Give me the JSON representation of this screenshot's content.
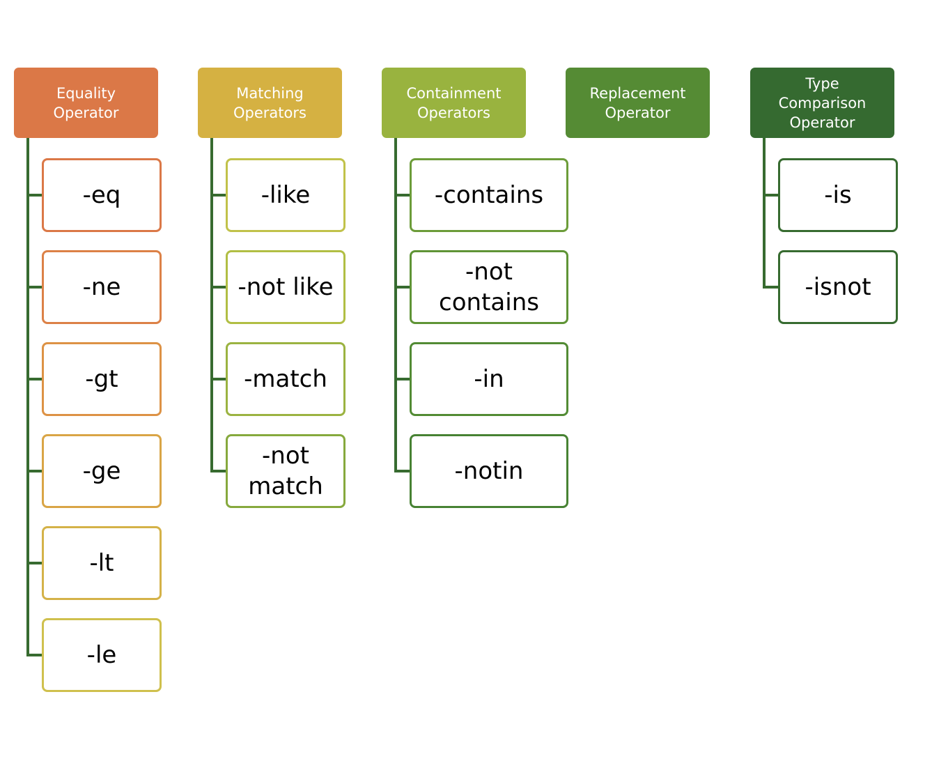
{
  "diagram": {
    "connector_color": "#376b30",
    "groups": [
      {
        "title": "Equality\nOperator",
        "color": "#db7847",
        "children": [
          {
            "label": "-eq",
            "border": "#db7847"
          },
          {
            "label": "-ne",
            "border": "#dc8147"
          },
          {
            "label": "-gt",
            "border": "#dd9245"
          },
          {
            "label": "-ge",
            "border": "#d9a546"
          },
          {
            "label": "-lt",
            "border": "#d4b248"
          },
          {
            "label": "-le",
            "border": "#cfc04d"
          }
        ]
      },
      {
        "title": "Matching\nOperators",
        "color": "#d5b142",
        "children": [
          {
            "label": "-like",
            "border": "#c1c24a"
          },
          {
            "label": "-not like",
            "border": "#b1be44"
          },
          {
            "label": "-match",
            "border": "#9bb341"
          },
          {
            "label": "-not\nmatch",
            "border": "#86a93d"
          }
        ]
      },
      {
        "title": "Containment\nOperators",
        "color": "#99b33f",
        "children": [
          {
            "label": "-contains",
            "border": "#6c9c39"
          },
          {
            "label": "-not\ncontains",
            "border": "#5f9436"
          },
          {
            "label": "-in",
            "border": "#528b34"
          },
          {
            "label": "-notin",
            "border": "#478233"
          }
        ]
      },
      {
        "title": "Replacement\nOperator",
        "color": "#558b34",
        "children": []
      },
      {
        "title": "Type\nComparison\nOperator",
        "color": "#356a30",
        "children": [
          {
            "label": "-is",
            "border": "#376b30"
          },
          {
            "label": "-isnot",
            "border": "#376b30"
          }
        ]
      }
    ]
  }
}
